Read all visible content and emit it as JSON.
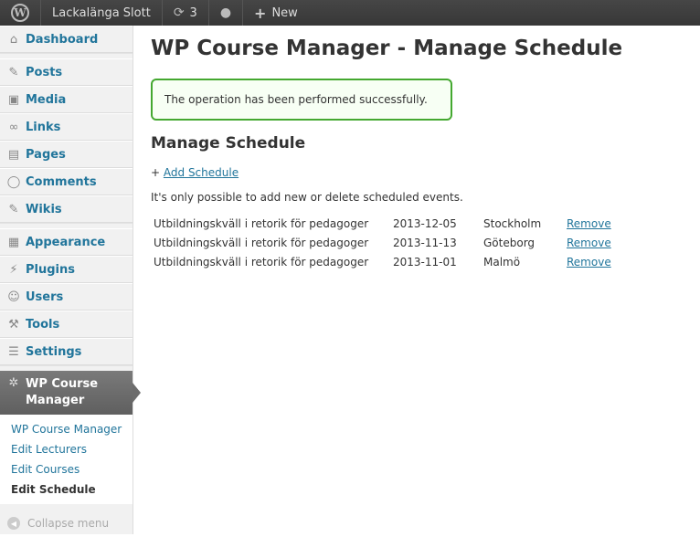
{
  "adminbar": {
    "site_name": "Lackalänga Slott",
    "updates_count": "3",
    "new_label": "New"
  },
  "sidebar": {
    "top": [
      {
        "label": "Dashboard",
        "icon": "dashboard-icon"
      }
    ],
    "content": [
      {
        "label": "Posts",
        "icon": "pushpin-icon"
      },
      {
        "label": "Media",
        "icon": "media-icon"
      },
      {
        "label": "Links",
        "icon": "link-icon"
      },
      {
        "label": "Pages",
        "icon": "pages-icon"
      },
      {
        "label": "Comments",
        "icon": "comment-icon"
      },
      {
        "label": "Wikis",
        "icon": "pushpin-icon"
      }
    ],
    "admin": [
      {
        "label": "Appearance",
        "icon": "appearance-icon"
      },
      {
        "label": "Plugins",
        "icon": "plugin-icon"
      },
      {
        "label": "Users",
        "icon": "users-icon"
      },
      {
        "label": "Tools",
        "icon": "tools-icon"
      },
      {
        "label": "Settings",
        "icon": "settings-icon"
      }
    ],
    "current": {
      "label": "WP Course Manager",
      "icon": "gear-icon"
    },
    "submenu": [
      "WP Course Manager",
      "Edit Lecturers",
      "Edit Courses",
      "Edit Schedule"
    ],
    "collapse_label": "Collapse menu"
  },
  "main": {
    "title": "WP Course Manager - Manage Schedule",
    "notice": "The operation has been performed successfully.",
    "section_title": "Manage Schedule",
    "add_prefix": "+",
    "add_link": "Add Schedule",
    "info_text": "It's only possible to add new or delete scheduled events.",
    "remove_label": "Remove",
    "rows": [
      {
        "title": "Utbildningskväll i retorik för pedagoger",
        "date": "2013-12-05",
        "city": "Stockholm"
      },
      {
        "title": "Utbildningskväll i retorik för pedagoger",
        "date": "2013-11-13",
        "city": "Göteborg"
      },
      {
        "title": "Utbildningskväll i retorik för pedagoger",
        "date": "2013-11-01",
        "city": "Malmö"
      }
    ]
  },
  "colors": {
    "link": "#21759b",
    "success_border": "#44a830",
    "adminbar": "#464646"
  }
}
